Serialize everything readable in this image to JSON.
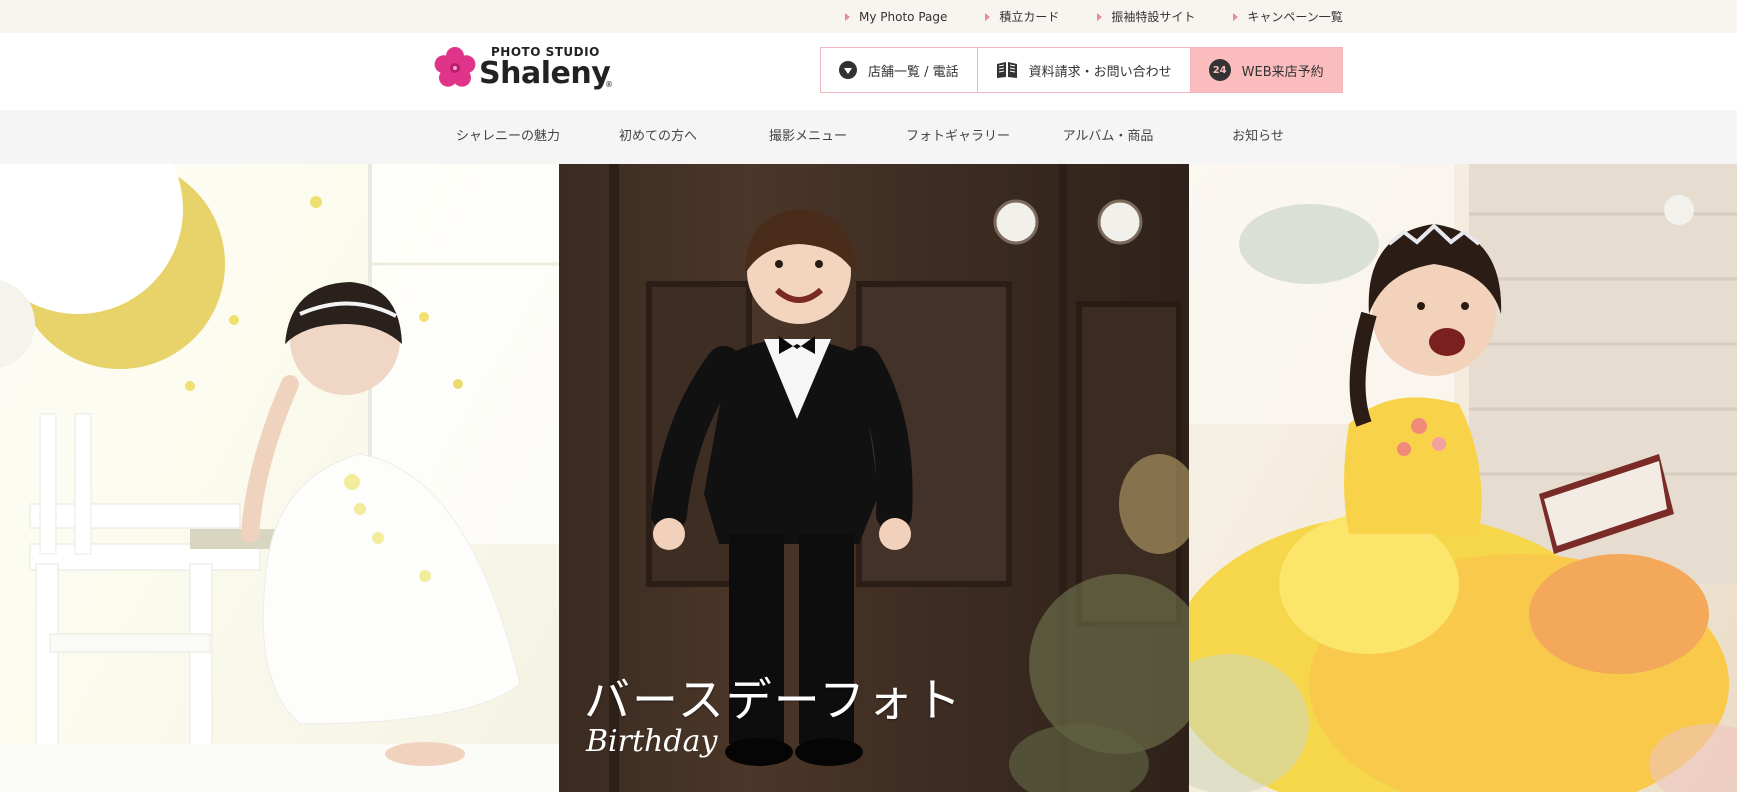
{
  "topbar": {
    "links": [
      {
        "label": "My Photo Page"
      },
      {
        "label": "積立カード"
      },
      {
        "label": "振袖特設サイト"
      },
      {
        "label": "キャンペーン一覧"
      }
    ]
  },
  "logo": {
    "studio": "PHOTO STUDIO",
    "name": "Shaleny",
    "reg": "®"
  },
  "header_buttons": {
    "stores": "店舗一覧 / 電話",
    "inquiry": "資料請求・お問い合わせ",
    "reserve": "WEB来店予約",
    "reserve_badge": "24"
  },
  "nav": {
    "items": [
      {
        "label": "シャレニーの魅力"
      },
      {
        "label": "初めての方へ"
      },
      {
        "label": "撮影メニュー"
      },
      {
        "label": "フォトギャラリー"
      },
      {
        "label": "アルバム・商品"
      },
      {
        "label": "お知らせ"
      }
    ]
  },
  "hero": {
    "title": "バースデーフォト",
    "subtitle": "Birthday"
  },
  "colors": {
    "accent_pink": "#fbbcbd",
    "border_pink": "#f2b7bd",
    "logo_magenta": "#e0338a",
    "topbar_bg": "#f8f4ef",
    "nav_bg": "#f5f5f5"
  }
}
